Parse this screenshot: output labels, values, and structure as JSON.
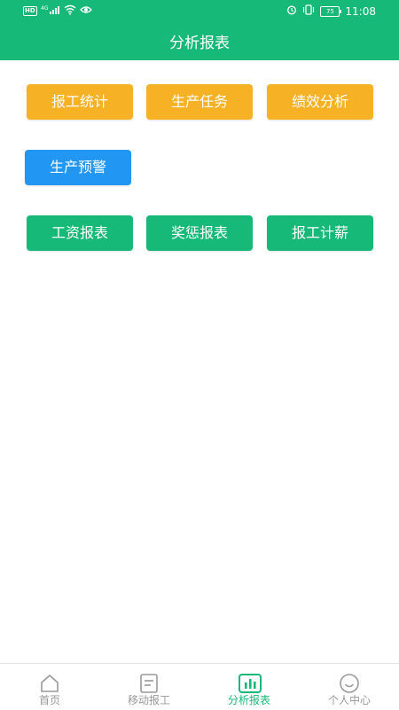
{
  "status_bar": {
    "left_badge": "HD",
    "signal_label": "4G",
    "battery": "75",
    "time": "11:08"
  },
  "header": {
    "title": "分析报表"
  },
  "buttons": {
    "row1": [
      "报工统计",
      "生产任务",
      "绩效分析"
    ],
    "row2": [
      "生产预警"
    ],
    "row3": [
      "工资报表",
      "奖惩报表",
      "报工计薪"
    ]
  },
  "tabs": [
    {
      "label": "首页",
      "icon": "home-icon",
      "active": false
    },
    {
      "label": "移动报工",
      "icon": "document-icon",
      "active": false
    },
    {
      "label": "分析报表",
      "icon": "chart-icon",
      "active": true
    },
    {
      "label": "个人中心",
      "icon": "smile-icon",
      "active": false
    }
  ],
  "colors": {
    "primary_green": "#17b978",
    "orange": "#f7b125",
    "blue": "#2196f3",
    "tab_inactive": "#999999"
  }
}
